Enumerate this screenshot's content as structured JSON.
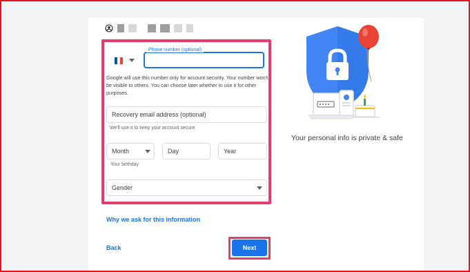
{
  "header": {
    "account_icon": "account-circle-icon"
  },
  "form": {
    "country_flag": "france-flag-icon",
    "phone_label": "Phone number (optional)",
    "phone_value": "",
    "phone_note": "Google will use this number only for account security. Your number won't be visible to others. You can choose later whether to use it for other purposes.",
    "recovery_placeholder": "Recovery email address (optional)",
    "recovery_helper": "We'll use it to keep your account secure",
    "month_label": "Month",
    "day_placeholder": "Day",
    "year_placeholder": "Year",
    "birthday_helper": "Your birthday",
    "gender_label": "Gender"
  },
  "links": {
    "why": "Why we ask for this information",
    "back": "Back"
  },
  "buttons": {
    "next": "Next"
  },
  "side": {
    "caption": "Your personal info is private & safe"
  },
  "colors": {
    "accent": "#1a73e8",
    "highlight": "#e53d6b",
    "frame": "#e8101e"
  }
}
